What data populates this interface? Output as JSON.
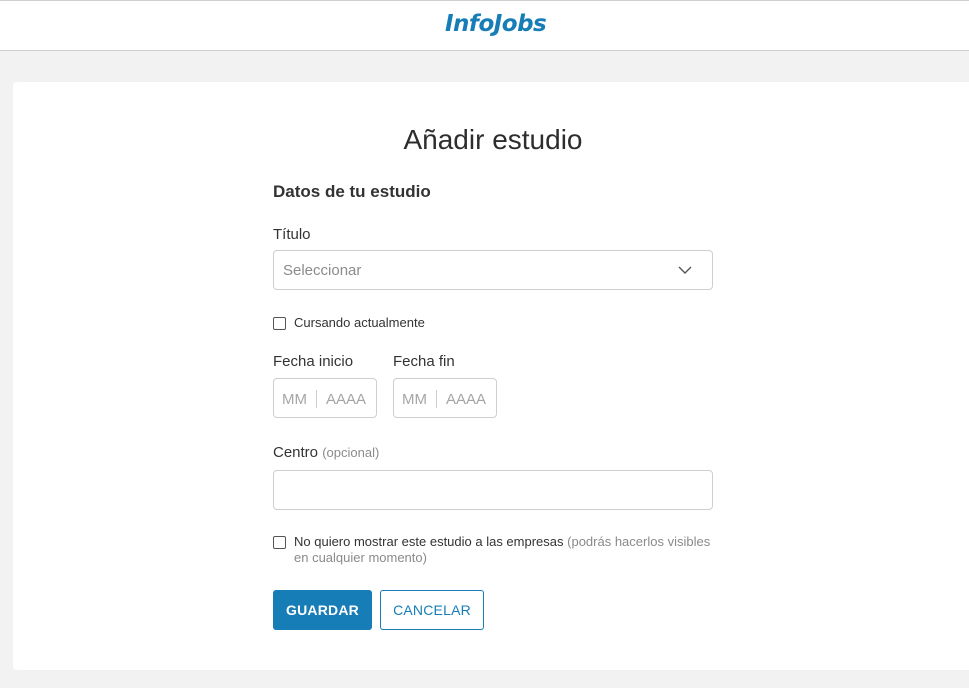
{
  "header": {
    "logo_text": "InfoJobs"
  },
  "form": {
    "title": "Añadir estudio",
    "section_title": "Datos de tu estudio",
    "titulo": {
      "label": "Título",
      "placeholder": "Seleccionar",
      "icon": "chevron-down-icon"
    },
    "cursando": {
      "label": "Cursando actualmente",
      "checked": false
    },
    "fecha_inicio": {
      "label": "Fecha inicio",
      "month_placeholder": "MM",
      "year_placeholder": "AAAA"
    },
    "fecha_fin": {
      "label": "Fecha fin",
      "month_placeholder": "MM",
      "year_placeholder": "AAAA"
    },
    "centro": {
      "label": "Centro",
      "optional": "(opcional)",
      "value": ""
    },
    "ocultar": {
      "label": "No quiero mostrar este estudio a las empresas",
      "hint": "(podrás hacerlos visibles en cualquier momento)",
      "checked": false
    },
    "buttons": {
      "save": "GUARDAR",
      "cancel": "CANCELAR"
    }
  },
  "colors": {
    "brand": "#167db7",
    "background": "#f2f2f2"
  }
}
